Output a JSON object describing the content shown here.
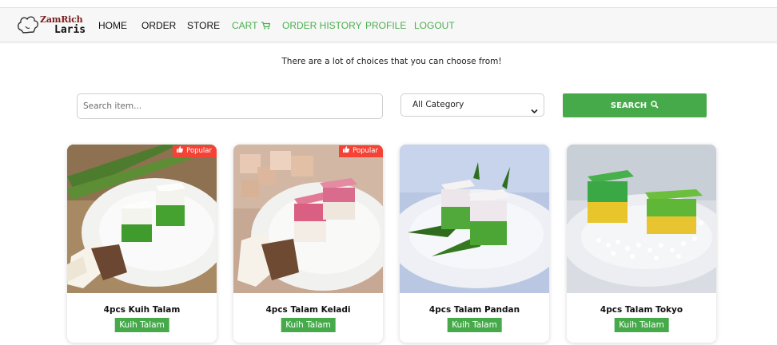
{
  "brand": {
    "line1": "ZamRich",
    "line2": "Laris"
  },
  "nav": {
    "home": "HOME",
    "order": "ORDER",
    "store": "STORE",
    "cart": "CART",
    "order_history": "ORDER HISTORY",
    "profile": "PROFILE",
    "logout": "LOGOUT"
  },
  "tagline": "There are a lot of choices that you can choose from!",
  "search": {
    "placeholder": "Search item...",
    "category_selected": "All Category",
    "button_label": "SEARCH"
  },
  "products": [
    {
      "name": "4pcs Kuih Talam",
      "category": "Kuih Talam",
      "badge": "Popular"
    },
    {
      "name": "4pcs Talam Keladi",
      "category": "Kuih Talam",
      "badge": "Popular"
    },
    {
      "name": "4pcs Talam Pandan",
      "category": "Kuih Talam"
    },
    {
      "name": "4pcs Talam Tokyo",
      "category": "Kuih Talam"
    }
  ],
  "colors": {
    "accent_green": "#46aa4b",
    "nav_green": "#4caf50",
    "popular_red": "#f44336",
    "navbar_bg": "#f7f7f7"
  },
  "icons": {
    "cart": "cart-icon",
    "search": "search-icon",
    "popular": "thumbs-up-icon",
    "select": "chevron-down-icon",
    "logo": "chef-hat-icon"
  }
}
